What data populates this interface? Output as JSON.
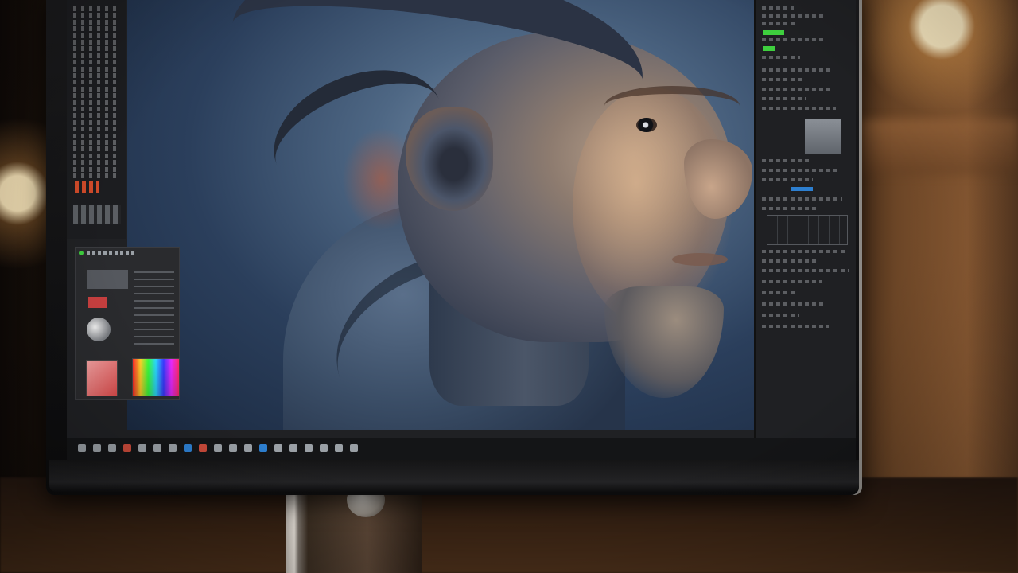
{
  "scene": {
    "description_colors": {
      "canvas_background": "#4e6784",
      "accent_green": "#3ecf3e",
      "accent_red": "#d14b2a",
      "accent_blue": "#2d7fd0",
      "room_light": "#ffe6b4"
    }
  },
  "taskbar": {
    "icons": [
      "app-icon",
      "app-icon",
      "app-icon",
      "app-icon",
      "app-icon",
      "app-icon",
      "app-icon",
      "app-icon",
      "app-icon",
      "app-icon",
      "app-icon",
      "app-icon",
      "app-icon",
      "app-icon",
      "app-icon",
      "app-icon",
      "app-icon",
      "app-icon",
      "app-icon"
    ]
  }
}
